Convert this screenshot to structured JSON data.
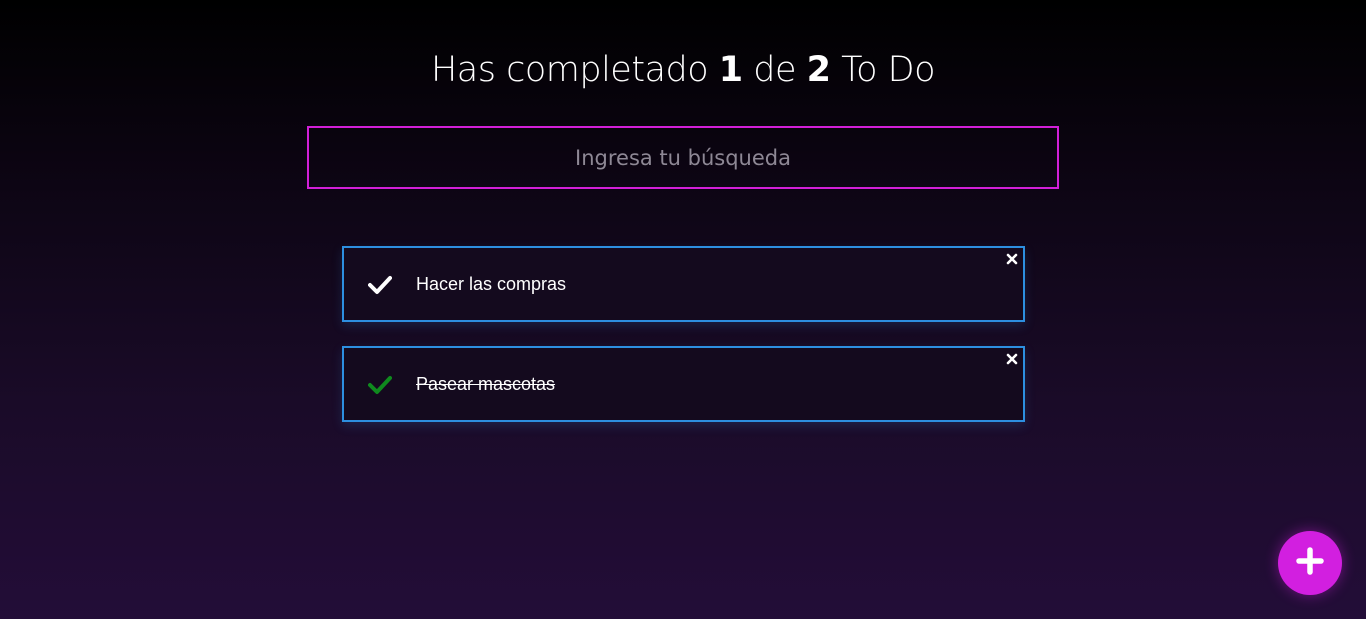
{
  "counter": {
    "prefix": "Has completado",
    "completed": "1",
    "middle": "de",
    "total": "2",
    "suffix": "To Do"
  },
  "search": {
    "placeholder": "Ingresa tu búsqueda",
    "value": ""
  },
  "todos": [
    {
      "text": "Hacer las compras",
      "completed": false,
      "check_icon": "check-icon",
      "delete_icon": "close-icon"
    },
    {
      "text": "Pasear mascotas",
      "completed": true,
      "check_icon": "check-icon",
      "delete_icon": "close-icon"
    }
  ],
  "create_button": {
    "icon": "plus-icon"
  },
  "colors": {
    "search_border": "#d21fd8",
    "card_border": "#2d8fe0",
    "check_default": "#ffffff",
    "check_completed": "#0f8a1e",
    "fab": "#d21fe0"
  }
}
